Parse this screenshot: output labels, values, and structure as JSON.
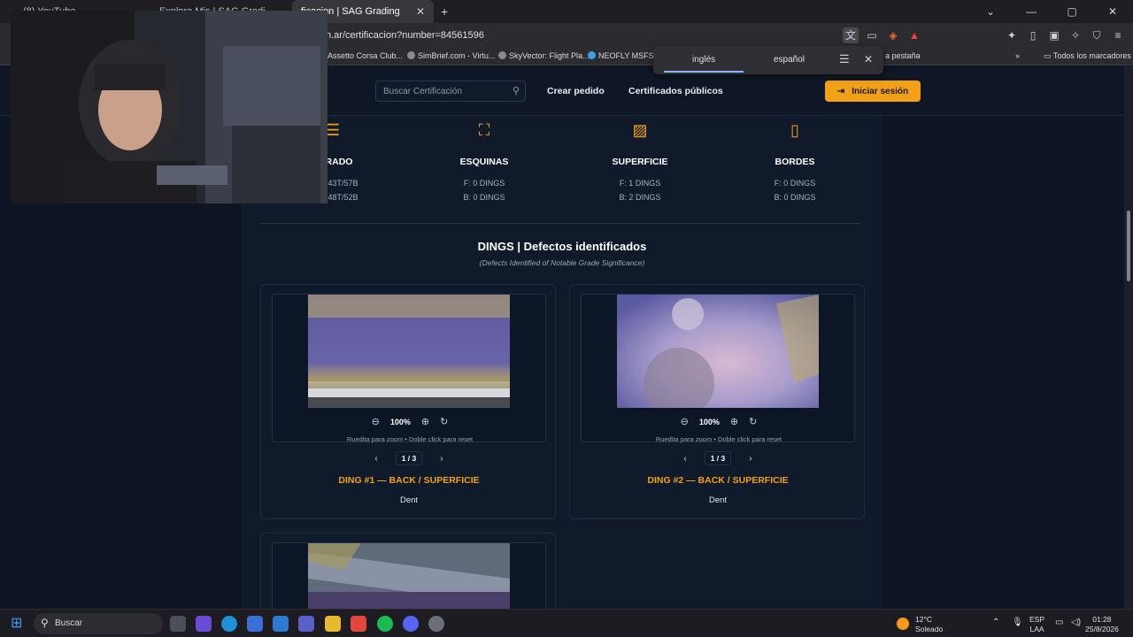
{
  "browser": {
    "tabs": [
      {
        "label": "(8) YouTube"
      },
      {
        "label": "Explora Mis | SAG Gradi"
      },
      {
        "label": "ficacion | SAG Grading",
        "active": true
      }
    ],
    "url": "n.ar/certificacion?number=84561596",
    "bookmarks": [
      "Assetto Corsa Club...",
      "SimBrief.com - Virtu...",
      "SkyVector: Flight Pla...",
      "NEOFLY MSFS Ca",
      "a pestaña",
      "Todos los marcadores"
    ],
    "translate": {
      "lang1": "inglés",
      "lang2": "español"
    }
  },
  "nav": {
    "search_placeholder": "Buscar Certificación",
    "links": [
      "Crear pedido",
      "Certificados públicos"
    ],
    "login": "Iniciar sesión"
  },
  "categories": [
    {
      "name": "RADO",
      "lines": [
        "R 43T/57B",
        "R 48T/52B"
      ],
      "icon": "centering-icon"
    },
    {
      "name": "ESQUINAS",
      "lines": [
        "F: 0 DINGS",
        "B: 0 DINGS"
      ],
      "icon": "corners-icon"
    },
    {
      "name": "SUPERFICIE",
      "lines": [
        "F: 1 DINGS",
        "B: 2 DINGS"
      ],
      "icon": "image-icon"
    },
    {
      "name": "BORDES",
      "lines": [
        "F: 0 DINGS",
        "B: 0 DINGS"
      ],
      "icon": "card-icon"
    }
  ],
  "dings_section": {
    "title": "DINGS | Defectos identificados",
    "subtitle": "(Defects Identified of Notable Grade Significance)"
  },
  "dings": [
    {
      "title": "DING #1 — BACK / SUPERFICIE",
      "type": "Dent",
      "zoom": "100%",
      "hint": "Ruedita para zoom • Doble click para reset",
      "page": "1 / 3"
    },
    {
      "title": "DING #2 — BACK / SUPERFICIE",
      "type": "Dent",
      "zoom": "100%",
      "hint": "Ruedita para zoom • Doble click para reset",
      "page": "1 / 3"
    }
  ],
  "taskbar": {
    "search": "Buscar",
    "weather_temp": "12°C",
    "weather_desc": "Soleado",
    "lang": "ESP",
    "lang2": "LAA",
    "time": "01:28",
    "date": "25/8/2026"
  },
  "colors": {
    "accent": "#f3a019",
    "bg": "#0d1422"
  }
}
